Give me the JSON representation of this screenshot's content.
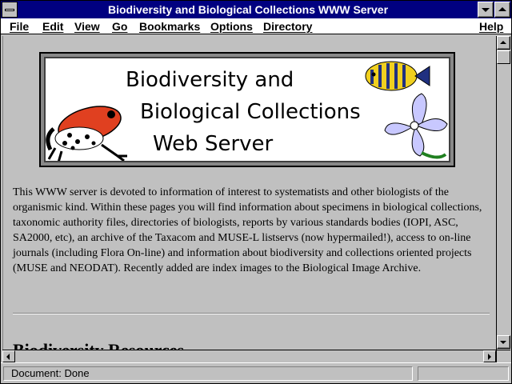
{
  "window": {
    "title": "Biodiversity and Biological Collections WWW Server"
  },
  "menu": [
    {
      "label": "File"
    },
    {
      "label": "Edit"
    },
    {
      "label": "View"
    },
    {
      "label": "Go"
    },
    {
      "label": "Bookmarks"
    },
    {
      "label": "Options"
    },
    {
      "label": "Directory"
    },
    {
      "label": "Help"
    }
  ],
  "banner": {
    "line1": "Biodiversity and",
    "line2": "Biological Collections",
    "line3": "Web Server"
  },
  "intro": "This WWW server is devoted to information of interest to systematists and other biologists of the organismic kind. Within these pages you will find information about specimens in biological collections, taxonomic authority files, directories of biologists, reports by various standards bodies (IOPI, ASC, SA2000, etc), an archive of the Taxacom and MUSE-L listservs (now hypermailed!), access to on-line journals (including Flora On-line) and information about biodiversity and collections oriented projects (MUSE and NEODAT). Recently added are index images to the Biological Image Archive.",
  "section_heading": "Biodiversity Resources",
  "status": {
    "text": "Document: Done"
  },
  "colors": {
    "titlebar": "#000080",
    "chrome": "#c0c0c0",
    "frog": "#e04020",
    "flower": "#c8c8ff"
  }
}
